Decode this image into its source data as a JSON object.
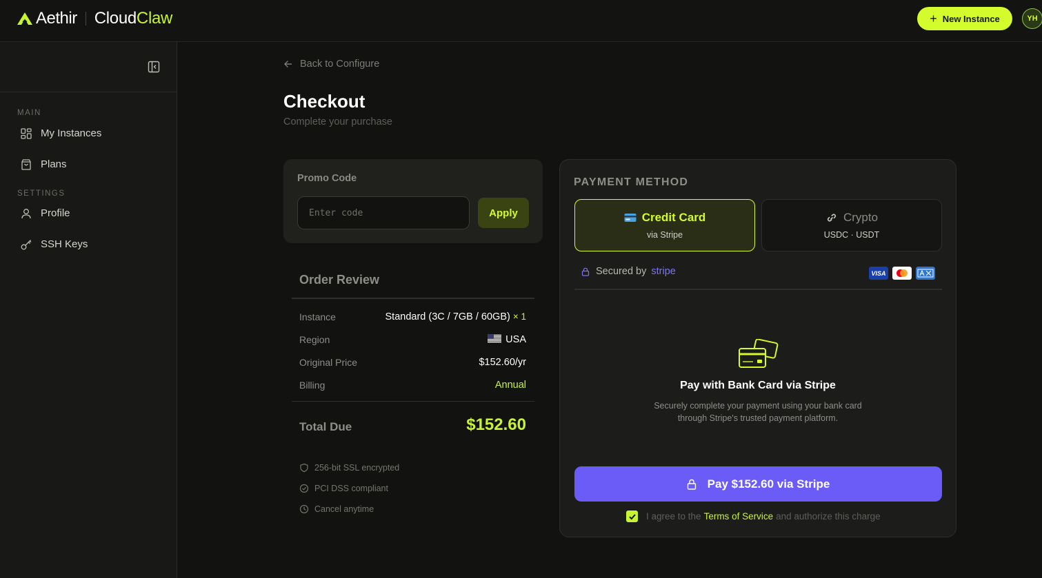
{
  "brand": {
    "name": "Aethir",
    "product_prefix": "Cloud",
    "product_accent": "Claw"
  },
  "header": {
    "new_instance_label": "New Instance",
    "avatar_initials": "YH"
  },
  "sidebar": {
    "sections": [
      {
        "title": "MAIN",
        "items": [
          {
            "label": "My Instances",
            "icon": "grid-icon"
          },
          {
            "label": "Plans",
            "icon": "bag-icon"
          }
        ]
      },
      {
        "title": "SETTINGS",
        "items": [
          {
            "label": "Profile",
            "icon": "user-icon"
          },
          {
            "label": "SSH Keys",
            "icon": "key-icon"
          }
        ]
      }
    ]
  },
  "page": {
    "back_label": "Back to Configure",
    "title": "Checkout",
    "subtitle": "Complete your purchase"
  },
  "promo": {
    "label": "Promo Code",
    "placeholder": "Enter code",
    "value": "",
    "apply_label": "Apply"
  },
  "order": {
    "title": "Order Review",
    "rows": [
      {
        "key": "Instance",
        "value": "Standard (3C / 7GB / 60GB)",
        "qty": "× 1"
      },
      {
        "key": "Region",
        "value": "USA",
        "flag": "us"
      },
      {
        "key": "Original Price",
        "value": "$152.60/yr"
      },
      {
        "key": "Billing",
        "value": "Annual"
      }
    ],
    "total_label": "Total Due",
    "total_value": "$152.60",
    "assurances": [
      {
        "icon": "shield-icon",
        "label": "256-bit SSL encrypted"
      },
      {
        "icon": "check-circle-icon",
        "label": "PCI DSS compliant"
      },
      {
        "icon": "clock-icon",
        "label": "Cancel anytime"
      }
    ]
  },
  "payment": {
    "title": "PAYMENT METHOD",
    "options": [
      {
        "name": "Credit Card",
        "sub": "via Stripe",
        "selected": true,
        "icon": "credit-card-icon"
      },
      {
        "name": "Crypto",
        "sub": "USDC · USDT",
        "selected": false,
        "icon": "link-icon"
      }
    ],
    "secured_prefix": "Secured by",
    "secured_brand": "stripe",
    "card_badges": [
      "visa",
      "mastercard",
      "amex"
    ],
    "panel_title": "Pay with Bank Card via Stripe",
    "panel_desc_line1": "Securely complete your payment using your bank card",
    "panel_desc_line2": "through Stripe's trusted payment platform.",
    "pay_label": "Pay $152.60 via Stripe",
    "agree_prefix": "I agree to the",
    "agree_link": "Terms of Service",
    "agree_suffix": "and authorize this charge",
    "agree_checked": true
  },
  "colors": {
    "accent": "#d4fc2c",
    "stripe": "#6b5cf7",
    "background": "#121210"
  }
}
